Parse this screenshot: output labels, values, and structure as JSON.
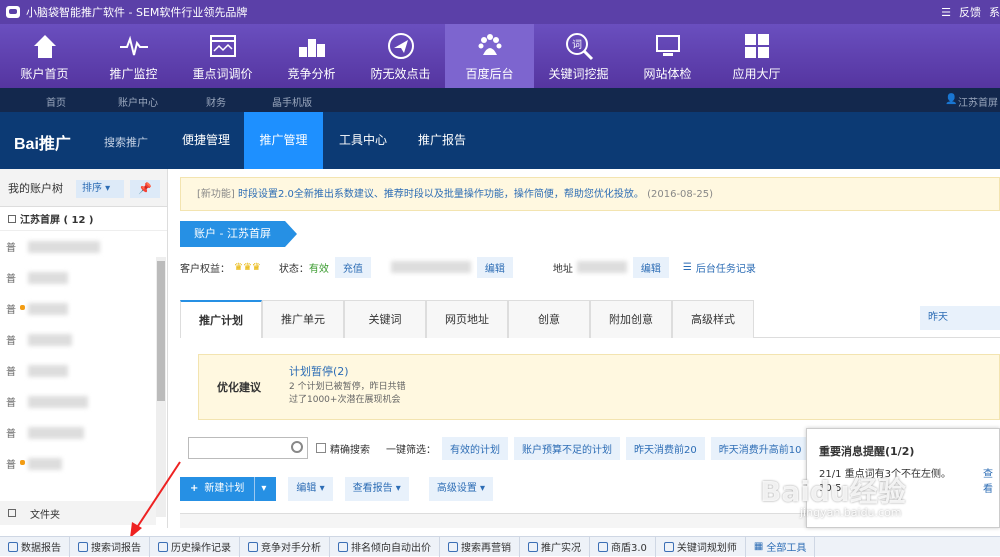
{
  "titlebar": {
    "title": "小脑袋智能推广软件 - SEM软件行业领先品牌",
    "feedback": "反馈",
    "extra": "系"
  },
  "ribbon": [
    {
      "label": "账户首页",
      "icon": "home-icon"
    },
    {
      "label": "推广监控",
      "icon": "pulse-icon"
    },
    {
      "label": "重点词调价",
      "icon": "window-icon"
    },
    {
      "label": "竞争分析",
      "icon": "podium-icon"
    },
    {
      "label": "防无效点击",
      "icon": "plane-icon"
    },
    {
      "label": "百度后台",
      "icon": "baidu-paw-icon"
    },
    {
      "label": "关键词挖掘",
      "icon": "word-search-icon"
    },
    {
      "label": "网站体检",
      "icon": "monitor-icon"
    },
    {
      "label": "应用大厅",
      "icon": "grid-icon"
    }
  ],
  "nav2": {
    "items": [
      "首页",
      "账户中心",
      "财务",
      "晶手机版"
    ],
    "user": "江苏首屏"
  },
  "baidu": {
    "logo": "Bai推广",
    "sub": "搜索推广",
    "tabs": [
      "便捷管理",
      "推广管理",
      "工具中心",
      "推广报告"
    ]
  },
  "sidebar": {
    "title": "我的账户树",
    "sort": "排序",
    "pin": "📌",
    "group": "江苏首屏 ( 12 )",
    "rows": [
      "普",
      "普",
      "普",
      "普",
      "普",
      "普",
      "普",
      "普"
    ],
    "folder": "文件夹"
  },
  "notice": {
    "tag": "[新功能]",
    "text": "时段设置2.0全新推出系数建议、推荐时段以及批量操作功能，操作简便，帮助您优化投放。",
    "date": "(2016-08-25)"
  },
  "crumb": "账户 - 江苏首屏",
  "acct": {
    "rights": "客户权益：",
    "status_label": "状态：",
    "status": "有效",
    "recharge": "充值",
    "edit": "编辑",
    "addr": "地址",
    "edit2": "编辑",
    "task": "后台任务记录"
  },
  "tabs": [
    "推广计划",
    "推广单元",
    "关键词",
    "网页地址",
    "创意",
    "附加创意",
    "高级样式"
  ],
  "date": "昨天",
  "suggest": {
    "label": "优化建议",
    "link": "计划暂停(2)",
    "line1": "2 个计划已被暂停，昨日共错",
    "line2": "过了1000+次潜在展现机会"
  },
  "filter": {
    "precise": "精确搜索",
    "oneclick": "一键筛选：",
    "btns": [
      "有效的计划",
      "账户预算不足的计划",
      "昨天消费前20",
      "昨天消费升高前10"
    ]
  },
  "actions": {
    "new": "新建计划",
    "edit": "编辑",
    "report": "查看报告",
    "advanced": "高级设置"
  },
  "popup": {
    "title": "重要消息提醒(1/2)",
    "msg": "21/1   重点词有3个不在左侧。",
    "link": "查看",
    "time": "10:5"
  },
  "bottom": [
    "数据报告",
    "搜索词报告",
    "历史操作记录",
    "竞争对手分析",
    "排名倾向自动出价",
    "搜索再营销",
    "推广实况",
    "商盾3.0",
    "关键词规划师",
    "全部工具"
  ],
  "watermark": {
    "big": "Baidu经验",
    "small": "jingyan.baidu.com"
  }
}
